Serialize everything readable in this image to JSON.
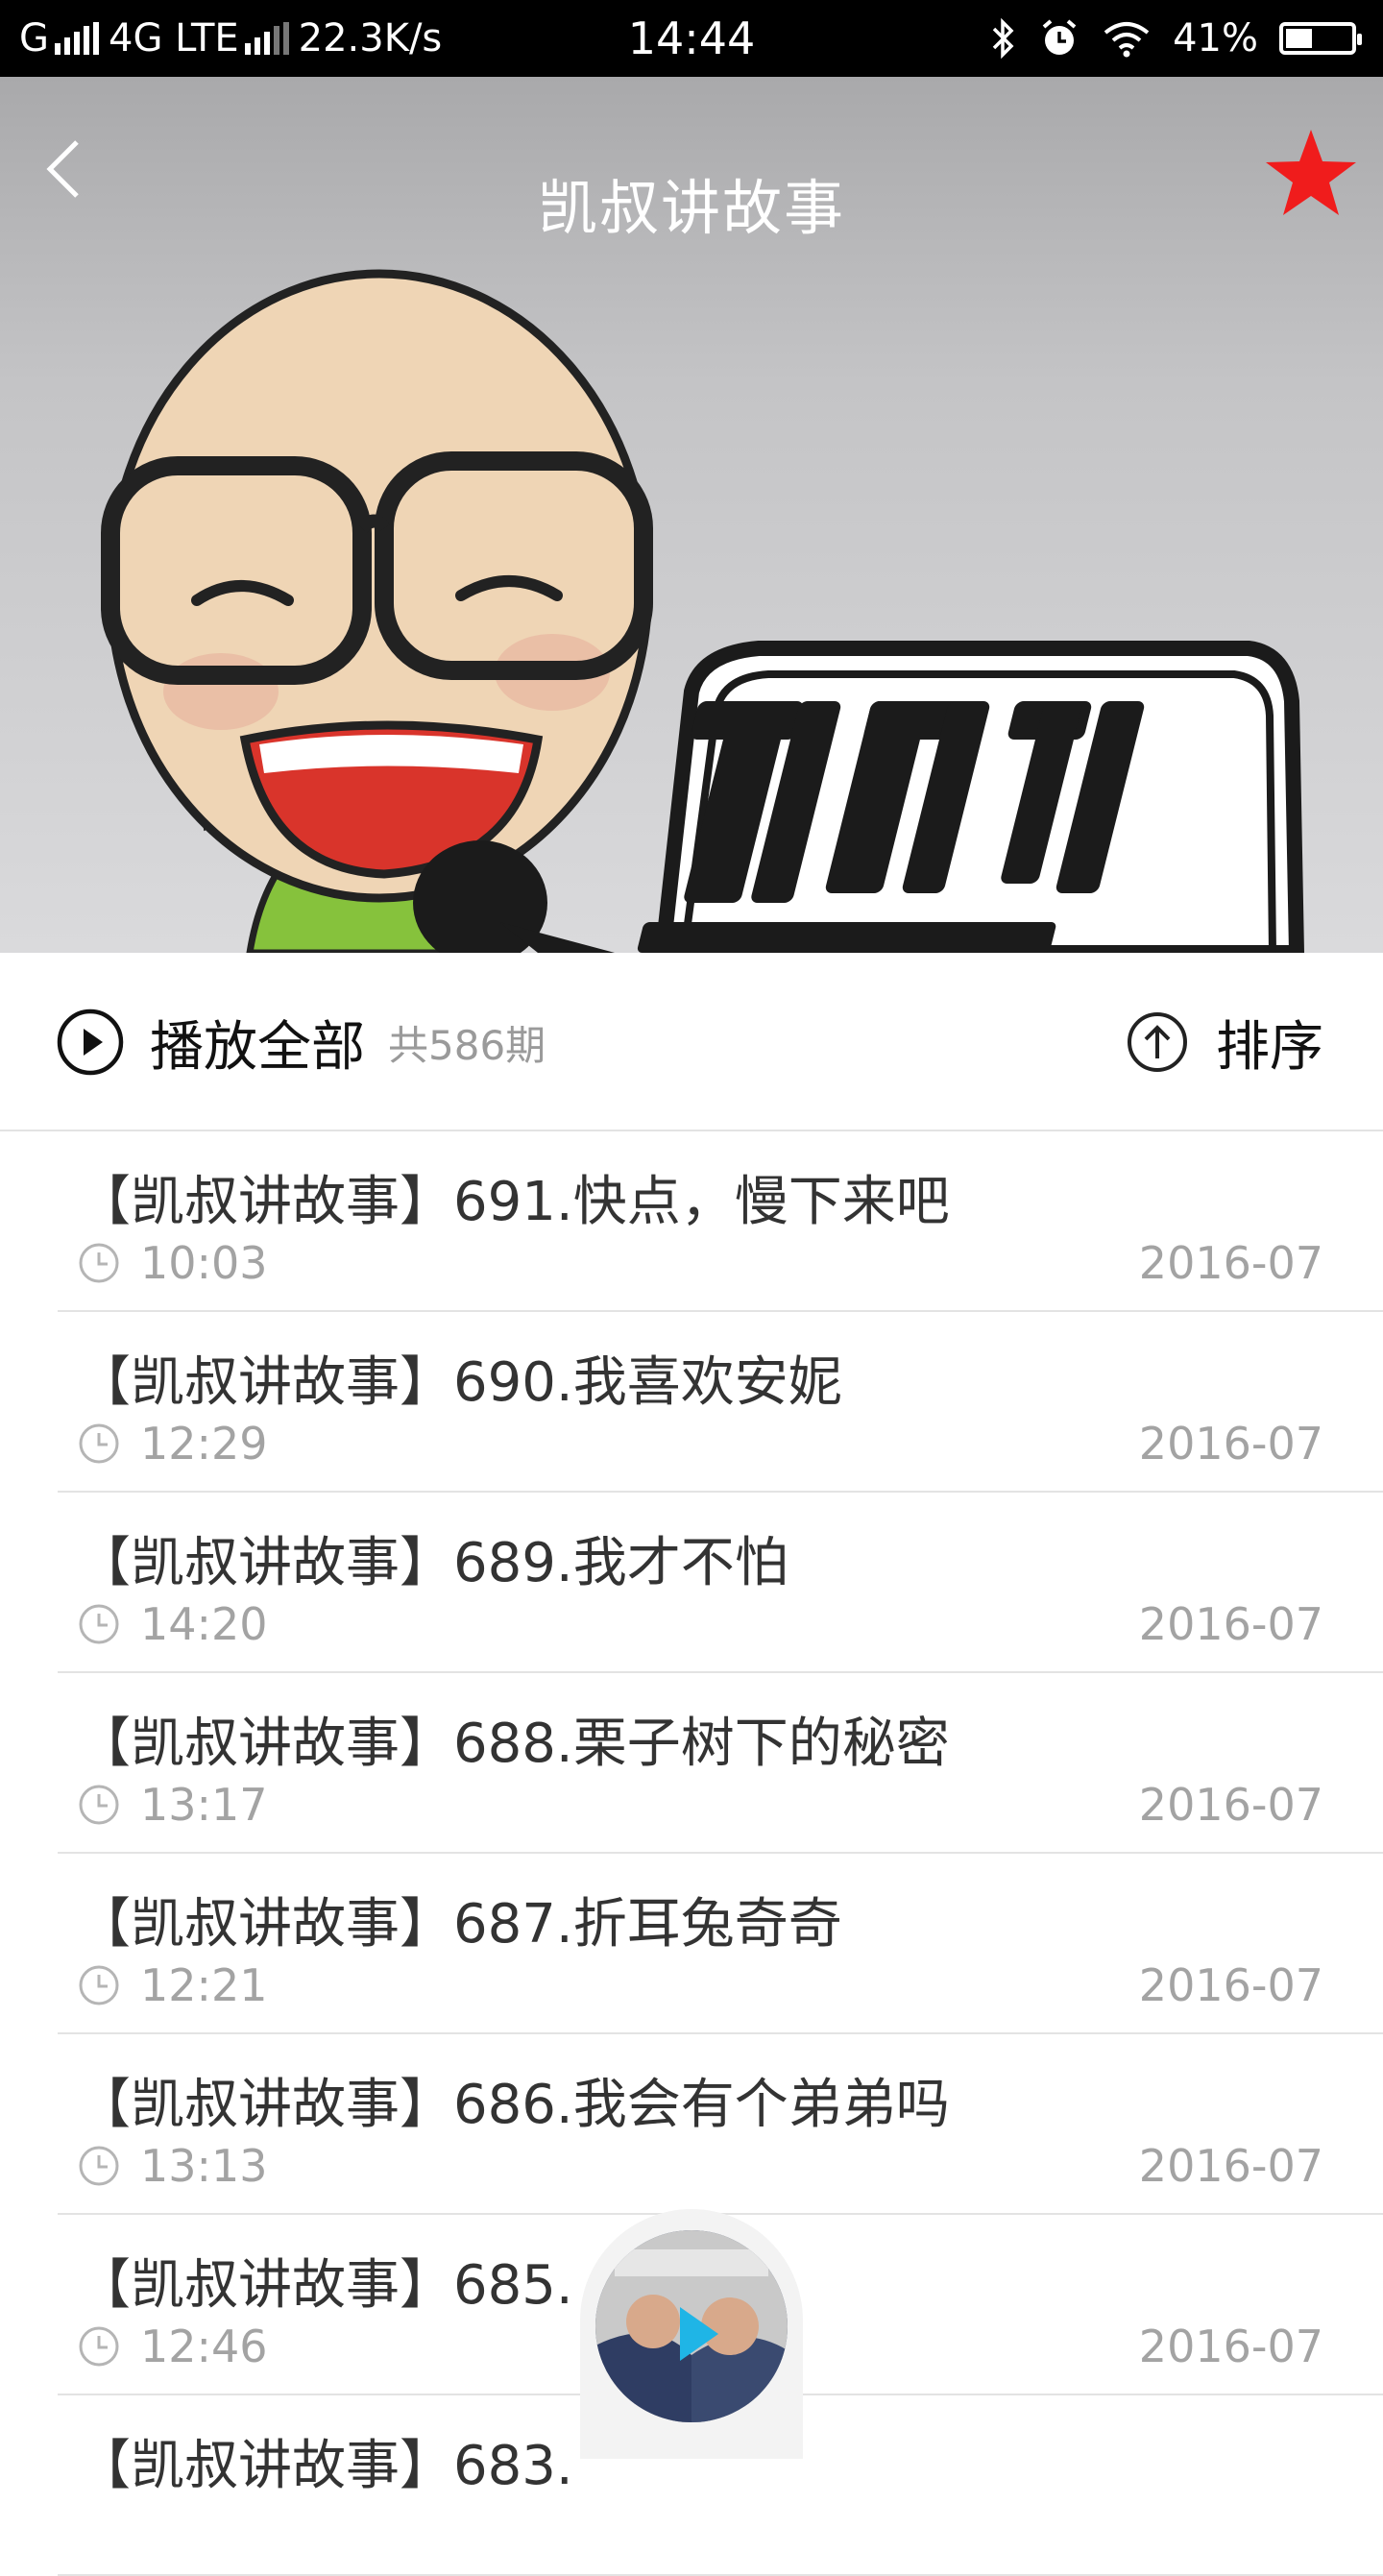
{
  "status_bar": {
    "carrier": "G",
    "network": "4G LTE",
    "speed": "22.3K/s",
    "time": "14:44",
    "battery": "41%",
    "battery_level": 0.41
  },
  "header": {
    "title": "凯叔讲故事"
  },
  "controls": {
    "play_all_label": "播放全部",
    "count_label": "共586期",
    "sort_label": "排序"
  },
  "episodes": [
    {
      "title": "【凯叔讲故事】691.快点，慢下来吧",
      "duration": "10:03",
      "date": "2016-07"
    },
    {
      "title": "【凯叔讲故事】690.我喜欢安妮",
      "duration": "12:29",
      "date": "2016-07"
    },
    {
      "title": "【凯叔讲故事】689.我才不怕",
      "duration": "14:20",
      "date": "2016-07"
    },
    {
      "title": "【凯叔讲故事】688.栗子树下的秘密",
      "duration": "13:17",
      "date": "2016-07"
    },
    {
      "title": "【凯叔讲故事】687.折耳兔奇奇",
      "duration": "12:21",
      "date": "2016-07"
    },
    {
      "title": "【凯叔讲故事】686.我会有个弟弟吗",
      "duration": "13:13",
      "date": "2016-07"
    },
    {
      "title": "【凯叔讲故事】685.",
      "duration": "12:46",
      "date": "2016-07"
    },
    {
      "title": "【凯叔讲故事】683.",
      "duration": "",
      "date": ""
    }
  ],
  "colors": {
    "accent_star": "#f01c1c",
    "meta_text": "#a3a3a3"
  }
}
